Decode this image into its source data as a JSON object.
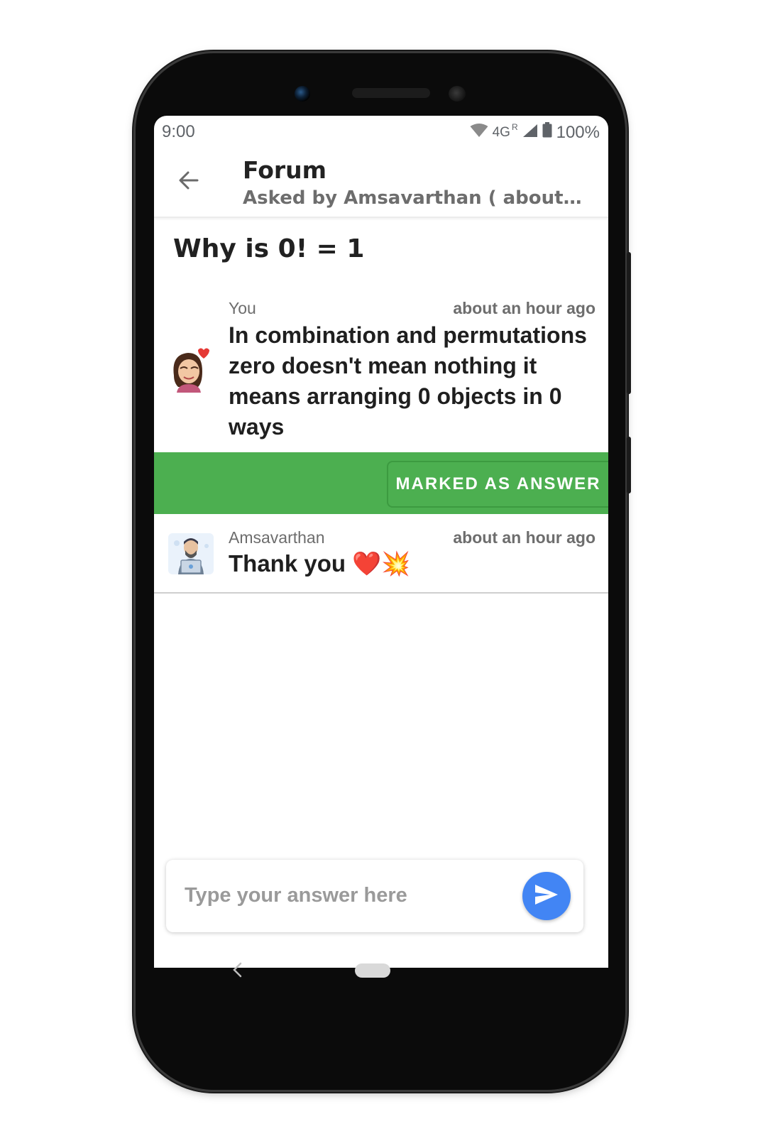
{
  "status_bar": {
    "time": "9:00",
    "network": "4G",
    "roaming": "R",
    "battery": "100%"
  },
  "app_bar": {
    "title": "Forum",
    "subtitle": "Asked by Amsavarthan ( about an h..."
  },
  "question": {
    "title": "Why is 0! = 1"
  },
  "answers": [
    {
      "author": "You",
      "time": "about an hour ago",
      "text": "In combination and permutations zero doesn't mean nothing it means arranging 0 objects in 0 ways",
      "marked_label": "MARKED AS ANSWER"
    },
    {
      "author": "Amsavarthan",
      "time": "about an hour ago",
      "text": "Thank you ❤️💥"
    }
  ],
  "composer": {
    "placeholder": "Type your answer here"
  },
  "colors": {
    "accent_green": "#4caf50",
    "send_blue": "#4285f4"
  },
  "icons": {
    "back": "arrow-left-icon",
    "send": "send-icon",
    "wifi": "wifi-icon",
    "signal": "signal-icon",
    "battery": "battery-icon"
  }
}
